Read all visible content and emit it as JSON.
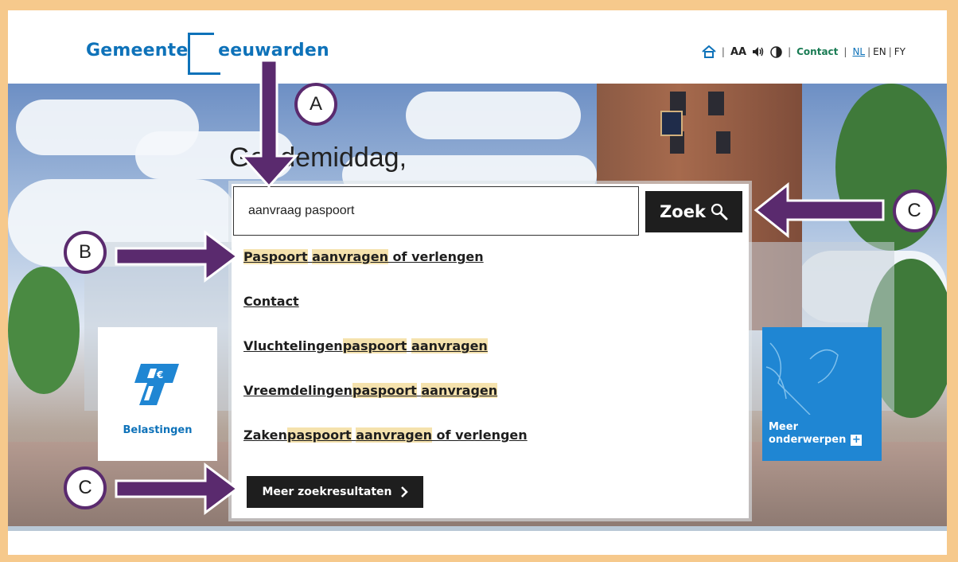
{
  "header": {
    "logo_part1": "Gemeente",
    "logo_part2": "eeuwarden",
    "nav": {
      "home_icon": "home-icon",
      "text_size": "AA",
      "contact": "Contact",
      "lang_nl": "NL",
      "lang_en": "EN",
      "lang_fy": "FY",
      "sep": "|"
    }
  },
  "hero": {
    "greeting": "Goedemiddag,"
  },
  "search": {
    "value": "aanvraag paspoort",
    "button_label": "Zoek"
  },
  "results": [
    {
      "parts": [
        {
          "t": "Paspoort",
          "h": true
        },
        {
          "t": " ",
          "h": false
        },
        {
          "t": "aanvragen",
          "h": true
        },
        {
          "t": " of verlengen",
          "h": false
        }
      ]
    },
    {
      "parts": [
        {
          "t": "Contact",
          "h": false
        }
      ]
    },
    {
      "parts": [
        {
          "t": "Vluchtelingen",
          "h": false
        },
        {
          "t": "paspoort",
          "h": true
        },
        {
          "t": " ",
          "h": false
        },
        {
          "t": "aanvragen",
          "h": true
        }
      ]
    },
    {
      "parts": [
        {
          "t": "Vreemdelingen",
          "h": false
        },
        {
          "t": "paspoort",
          "h": true
        },
        {
          "t": " ",
          "h": false
        },
        {
          "t": "aanvragen",
          "h": true
        }
      ]
    },
    {
      "parts": [
        {
          "t": "Zaken",
          "h": false
        },
        {
          "t": "paspoort",
          "h": true
        },
        {
          "t": " ",
          "h": false
        },
        {
          "t": "aanvragen",
          "h": true
        },
        {
          "t": " of verlengen",
          "h": false
        }
      ]
    }
  ],
  "more_results_label": "Meer zoekresultaten",
  "tiles": {
    "belastingen": "Belastingen",
    "meer_line1": "Meer",
    "meer_line2": "onderwerpen"
  },
  "callouts": {
    "a": "A",
    "b": "B",
    "c_top": "C",
    "c_bottom": "C"
  },
  "colors": {
    "brand_blue": "#0e72b9",
    "highlight": "#f5e2ad",
    "arrow_purple": "#5a2a6e",
    "frame_orange": "#f6c98c"
  }
}
